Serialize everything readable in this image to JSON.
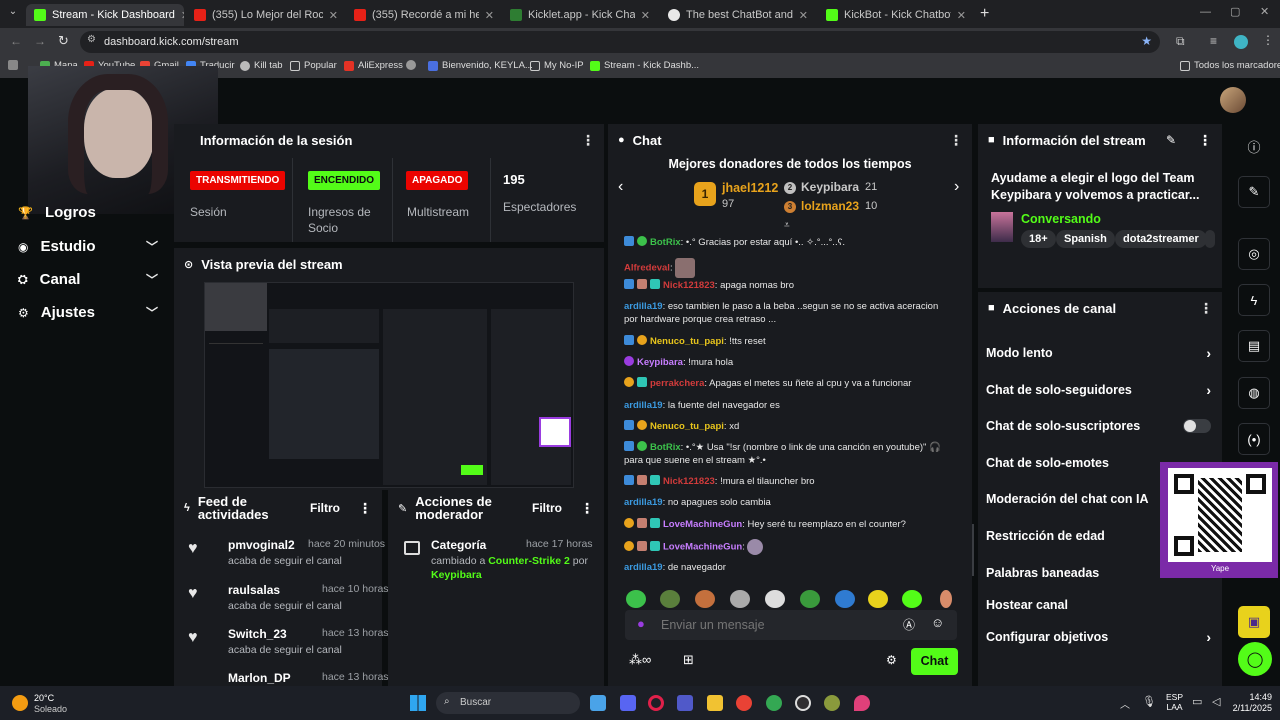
{
  "colors": {
    "kick_green": "#53fc18",
    "red_badge": "#eb0400",
    "panel_bg": "#191b1f",
    "page_bg": "#0b0e0f",
    "accent_purple": "#9a3ce0"
  },
  "browser": {
    "tabs": [
      {
        "title": "Stream - Kick Dashboard",
        "active": true
      },
      {
        "title": "(355) Lo Mejor del Rock en Esp",
        "active": false
      },
      {
        "title": "(355) Recordé a mi hermano en",
        "active": false
      },
      {
        "title": "Kicklet.app - Kick Chatbot and I",
        "active": false
      },
      {
        "title": "The best ChatBot and Widgets",
        "active": false
      },
      {
        "title": "KickBot - Kick Chatbot, Alerts, T",
        "active": false
      }
    ],
    "new_tab": "+",
    "url": "dashboard.kick.com/stream",
    "bookmarks": [
      "Mapa",
      "YouTube",
      "Gmail",
      "Traducir",
      "Kill tab",
      "Popular",
      "AliExpress",
      "",
      "Bienvenido, KEYLA...",
      "My No-IP",
      "Stream - Kick Dashb..."
    ],
    "all_bookmarks": "Todos los marcadores"
  },
  "sidebar": {
    "items": [
      {
        "label": "Logros",
        "icon": "trophy-icon"
      },
      {
        "label": "Estudio",
        "icon": "studio-icon"
      },
      {
        "label": "Canal",
        "icon": "channel-icon"
      },
      {
        "label": "Ajustes",
        "icon": "gear-icon"
      }
    ]
  },
  "session": {
    "title": "Información de la sesión",
    "badges": [
      "TRANSMITIENDO",
      "ENCENDIDO",
      "APAGADO"
    ],
    "stat_labels": [
      "Sesión",
      "Ingresos de Socio",
      "Multistream",
      "Espectadores"
    ],
    "viewers": "195"
  },
  "preview": {
    "title": "Vista previa del stream"
  },
  "feed": {
    "title": "Feed de actividades",
    "filter": "Filtro",
    "items": [
      {
        "name": "pmvoginal2",
        "time": "hace 20 minutos",
        "sub": "acaba de seguir el canal"
      },
      {
        "name": "raulsalas",
        "time": "hace 10 horas",
        "sub": "acaba de seguir el canal"
      },
      {
        "name": "Switch_23",
        "time": "hace 13 horas",
        "sub": "acaba de seguir el canal"
      },
      {
        "name": "Marlon_DP",
        "time": "hace 13 horas",
        "sub": ""
      }
    ]
  },
  "modactions": {
    "title": "Acciones de moderador",
    "filter": "Filtro",
    "item": {
      "name": "Categoría",
      "time": "hace 17 horas",
      "text_pre": "cambiado a ",
      "game": "Counter-Strike 2",
      "text_mid": " por ",
      "by": "Keypibara"
    }
  },
  "chat": {
    "title": "Chat",
    "donors_title": "Mejores donadores de todos los tiempos",
    "donors": [
      {
        "rank": "1",
        "name": "jhael1212",
        "amount": "97"
      },
      {
        "rank": "2",
        "name": "Keypibara",
        "amount": "21"
      },
      {
        "rank": "3",
        "name": "lolzman23",
        "amount": "10"
      }
    ],
    "messages": [
      {
        "user": "BotRix",
        "color": "#3cc14b",
        "text": "•.° Gracias por estar aquí •.. ✧.°...°..ʕ."
      },
      {
        "user": "Alfredeval",
        "color": "#d13b3b",
        "text": ""
      },
      {
        "user": "Nick121823",
        "color": "#d13b3b",
        "text": "apaga nomas bro"
      },
      {
        "user": "ardilla19",
        "color": "#3b9ae0",
        "text": "eso tambien le paso a la beba ..segun se no se activa aceracion por hardware porque crea retraso ..."
      },
      {
        "user": "Nenuco_tu_papi",
        "color": "#e8c51c",
        "text": "!tts reset"
      },
      {
        "user": "Keypibara",
        "color": "#c77dff",
        "text": "!mura hola"
      },
      {
        "user": "perrakchera",
        "color": "#d13b3b",
        "text": "Apagas el metes su ñete al cpu y va a funcionar"
      },
      {
        "user": "ardilla19",
        "color": "#3b9ae0",
        "text": "la fuente del navegador es"
      },
      {
        "user": "Nenuco_tu_papi",
        "color": "#e8c51c",
        "text": "xd"
      },
      {
        "user": "BotRix",
        "color": "#3cc14b",
        "text": "•.°★ Usa \"!sr (nombre o link de una canción en youtube)\" 🎧 para que suene en el stream ★°.•"
      },
      {
        "user": "Nick121823",
        "color": "#d13b3b",
        "text": "!mura el tilauncher bro"
      },
      {
        "user": "ardilla19",
        "color": "#3b9ae0",
        "text": "no apagues solo cambia"
      },
      {
        "user": "LoveMachineGun",
        "color": "#c77dff",
        "text": "Hey seré tu reemplazo en el counter?"
      },
      {
        "user": "LoveMachineGun",
        "color": "#c77dff",
        "text": ""
      },
      {
        "user": "ardilla19",
        "color": "#3b9ae0",
        "text": "de navegador"
      }
    ],
    "input_placeholder": "Enviar un mensaje",
    "send": "Chat"
  },
  "streaminfo": {
    "title": "Información del stream",
    "stream_title": "Ayudame a elegir el logo del Team Keypibara y volvemos a practicar...",
    "category": "Conversando",
    "tags": [
      "18+",
      "Spanish",
      "dota2streamer"
    ]
  },
  "channel_actions": {
    "title": "Acciones de canal",
    "items": [
      {
        "label": "Modo lento",
        "control": "chevron"
      },
      {
        "label": "Chat de solo-seguidores",
        "control": "chevron"
      },
      {
        "label": "Chat de solo-suscriptores",
        "control": "toggle"
      },
      {
        "label": "Chat de solo-emotes",
        "control": "toggle"
      },
      {
        "label": "Moderación del chat con IA",
        "control": "none"
      },
      {
        "label": "Restricción de edad",
        "control": "none"
      },
      {
        "label": "Palabras baneadas",
        "control": "none"
      },
      {
        "label": "Hostear canal",
        "control": "none"
      },
      {
        "label": "Configurar objetivos",
        "control": "chevron"
      }
    ]
  },
  "qr_caption": "Yape",
  "taskbar": {
    "weather_temp": "20°C",
    "weather_desc": "Soleado",
    "search": "Buscar",
    "lang1": "ESP",
    "lang2": "LAA",
    "time": "14:49",
    "date": "2/11/2025"
  }
}
